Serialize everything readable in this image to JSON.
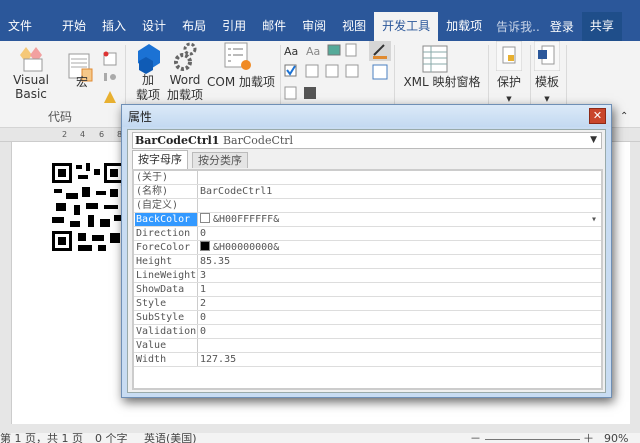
{
  "tabs": [
    "文件",
    "开始",
    "插入",
    "设计",
    "布局",
    "引用",
    "邮件",
    "审阅",
    "视图",
    "开发工具",
    "加载项"
  ],
  "active_tab": "开发工具",
  "tell_me": "告诉我..",
  "login": "登录",
  "share": "共享",
  "ribbon": {
    "visual_basic": "Visual Basic",
    "macro": "宏",
    "addins_1": "加",
    "addins_2": "载项",
    "word_addins_1": "Word",
    "word_addins_2": "加载项",
    "com_addins": "COM 加载项",
    "xml_pane": "XML 映射窗格",
    "protect": "保护",
    "template": "模板",
    "group_code": "代码"
  },
  "ruler_ticks": [
    "2",
    "4",
    "6",
    "8"
  ],
  "dialog": {
    "title": "属性",
    "object_name": "BarCodeCtrl1",
    "object_type": "BarCodeCtrl",
    "tab_alpha": "按字母序",
    "tab_category": "按分类序",
    "properties": [
      {
        "name": "(关于)",
        "value": ""
      },
      {
        "name": "(名称)",
        "value": "BarCodeCtrl1"
      },
      {
        "name": "(自定义)",
        "value": ""
      },
      {
        "name": "BackColor",
        "value": "&H00FFFFFF&",
        "swatch": "#ffffff",
        "selected": true
      },
      {
        "name": "Direction",
        "value": "0"
      },
      {
        "name": "ForeColor",
        "value": "&H00000000&",
        "swatch": "#000000"
      },
      {
        "name": "Height",
        "value": "85.35"
      },
      {
        "name": "LineWeight",
        "value": "3"
      },
      {
        "name": "ShowData",
        "value": "1"
      },
      {
        "name": "Style",
        "value": "2"
      },
      {
        "name": "SubStyle",
        "value": "0"
      },
      {
        "name": "Validation",
        "value": "0"
      },
      {
        "name": "Value",
        "value": ""
      },
      {
        "name": "Width",
        "value": "127.35"
      }
    ]
  },
  "status": {
    "page": "第 1 页，共 1 页",
    "words": "0 个字",
    "lang": "英语(美国)",
    "zoom": "90%"
  }
}
